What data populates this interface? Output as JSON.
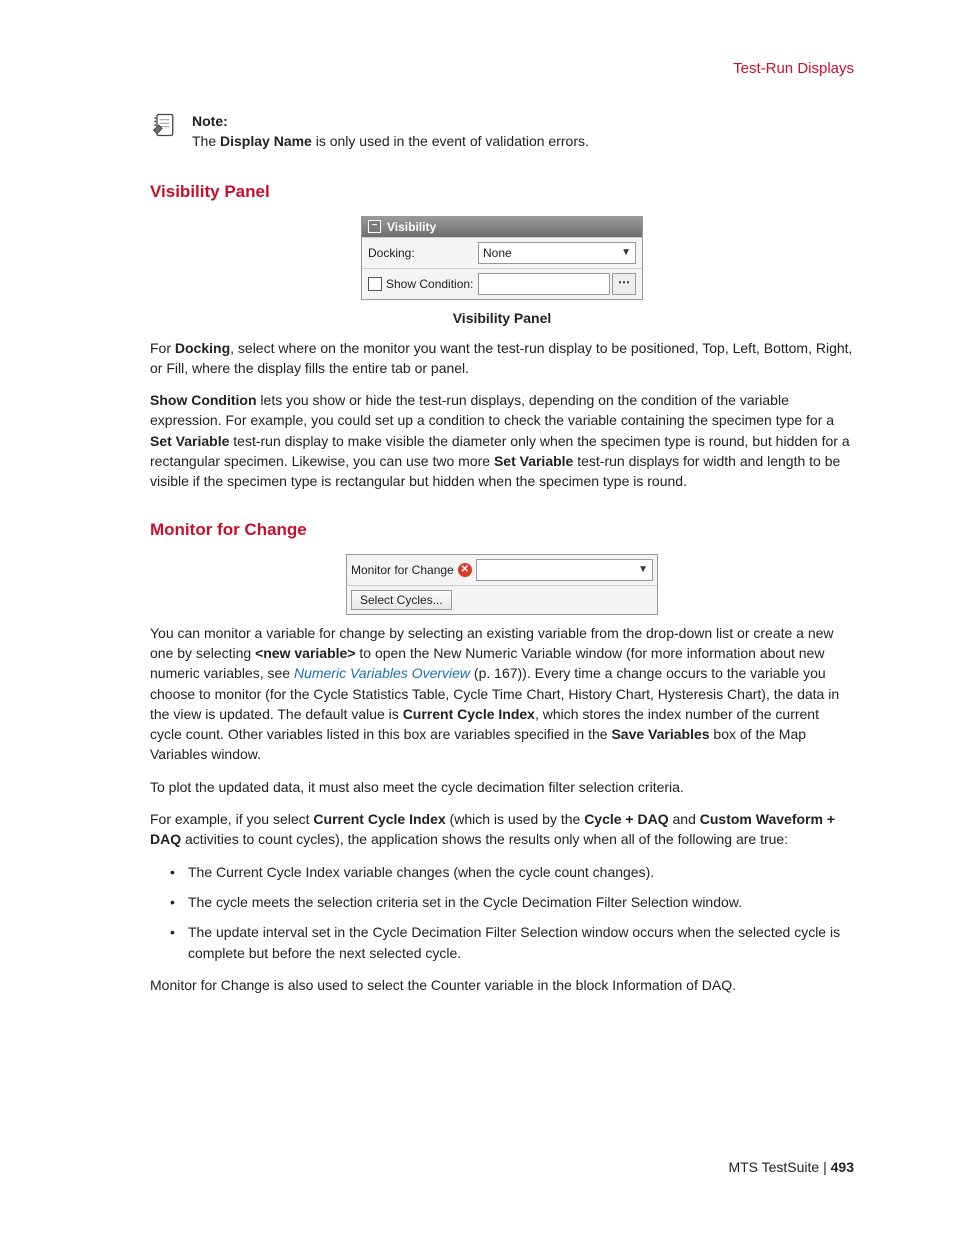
{
  "header": {
    "title": "Test-Run Displays"
  },
  "note": {
    "label": "Note:",
    "text_pre": "The ",
    "bold1": "Display Name",
    "text_post": " is only used in the event of validation errors."
  },
  "visibility": {
    "heading": "Visibility Panel",
    "panel_title": "Visibility",
    "docking_label": "Docking:",
    "docking_value": "None",
    "showcond_label": "Show Condition:",
    "caption": "Visibility Panel",
    "para1_pre": "For ",
    "para1_b1": "Docking",
    "para1_post": ", select where on the monitor you want the test-run display to be positioned, Top, Left, Bottom, Right, or Fill, where the display fills the entire tab or panel.",
    "para2_b1": "Show Condition",
    "para2_mid1": " lets you show or hide the test-run displays, depending on the condition of the variable expression. For example, you could set up a condition to check the variable containing the specimen type for a ",
    "para2_b2": "Set Variable",
    "para2_mid2": " test-run display to make visible the diameter only when the specimen type is round, but hidden for a rectangular specimen. Likewise, you can use two more ",
    "para2_b3": "Set Variable",
    "para2_post": " test-run displays for width and length to be visible if the specimen type is rectangular but hidden when the specimen type is round."
  },
  "monitor": {
    "heading": "Monitor for Change",
    "panel_label": "Monitor for Change",
    "select_cycles_btn": "Select Cycles...",
    "para1_pre": "You can monitor a variable for change by selecting an existing variable from the drop-down list or create a new one by selecting ",
    "para1_b1": "<new variable>",
    "para1_mid1": " to open the New Numeric Variable window (for more information about new numeric variables, see ",
    "para1_link": "Numeric Variables Overview",
    "para1_mid2": " (p. 167)). Every time a change occurs to the variable you choose to monitor (for the Cycle Statistics Table, Cycle Time Chart, History Chart, Hysteresis Chart), the data in the view is updated. The default value is ",
    "para1_b2": "Current Cycle Index",
    "para1_mid3": ", which stores the index number of the current cycle count. Other variables listed in this box are variables specified in the ",
    "para1_b3": "Save Variables",
    "para1_post": " box of the Map Variables window.",
    "para2": "To plot the updated data, it must also meet the cycle decimation filter selection criteria.",
    "para3_pre": "For example, if you select ",
    "para3_b1": "Current Cycle Index",
    "para3_mid1": " (which is used by the ",
    "para3_b2": "Cycle + DAQ",
    "para3_mid2": " and ",
    "para3_b3": "Custom Waveform + DAQ",
    "para3_post": " activities to count cycles), the application shows the results only when all of the following are true:",
    "bullets": [
      "The Current Cycle Index variable changes (when the cycle count changes).",
      "The cycle meets the selection criteria set in the Cycle Decimation Filter Selection window.",
      "The update interval set in the Cycle Decimation Filter Selection window occurs when the selected cycle is complete but before the next selected cycle."
    ],
    "para4": "Monitor for Change is also used to select the Counter variable in the block Information of DAQ."
  },
  "footer": {
    "product": "MTS TestSuite",
    "sep": " | ",
    "page": "493"
  }
}
